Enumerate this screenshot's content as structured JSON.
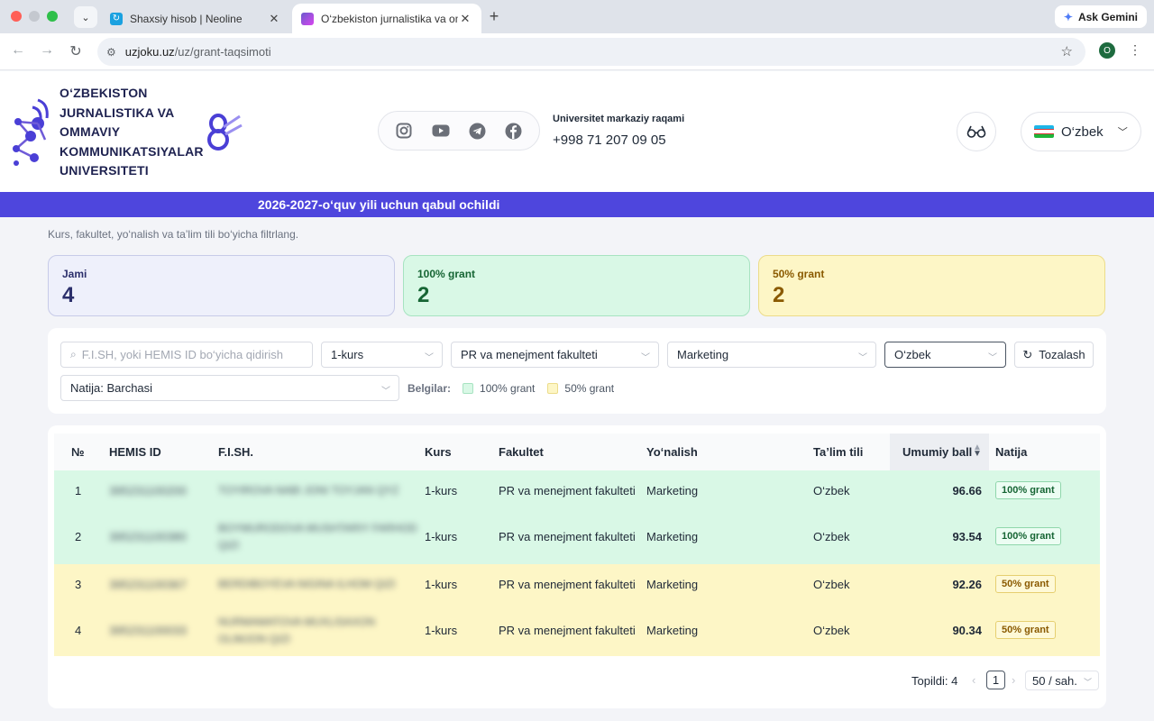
{
  "browser": {
    "tabs": [
      {
        "title": "Shaxsiy hisob | Neoline"
      },
      {
        "title": "O‘zbekiston jurnalistika va om"
      }
    ],
    "ask_gemini": "Ask Gemini",
    "url_host": "uzjoku.uz",
    "url_path": "/uz/grant-taqsimoti",
    "profile_initial": "O"
  },
  "header": {
    "logo_text": "O‘ZBEKISTON JURNALISTIKA VA OMMAVIY KOMMUNIKATSIYALAR UNIVERSITETI",
    "contact_label": "Universitet markaziy raqami",
    "contact_phone": "+998 71 207 09 05",
    "language": "O‘zbek",
    "socials": [
      "instagram-icon",
      "youtube-icon",
      "telegram-icon",
      "facebook-icon"
    ]
  },
  "banner": {
    "text": "2026-2027-o‘quv yili uchun qabul ochildi"
  },
  "page": {
    "subtitle": "Kurs, fakultet, yo‘nalish va ta’lim tili bo‘yicha filtrlang."
  },
  "stats": {
    "total_label": "Jami",
    "total_value": "4",
    "full_label": "100% grant",
    "full_value": "2",
    "half_label": "50% grant",
    "half_value": "2"
  },
  "filters": {
    "search_placeholder": "F.I.SH, yoki HEMIS ID bo‘yicha qidirish",
    "kurs": "1-kurs",
    "fakultet": "PR va menejment fakulteti",
    "yonalish": "Marketing",
    "til": "O‘zbek",
    "reset_label": "Tozalash",
    "natija": "Natija: Barchasi",
    "legend_title": "Belgilar:",
    "legend_full": "100% grant",
    "legend_half": "50% grant"
  },
  "table": {
    "headers": {
      "no": "№",
      "hemis": "HEMIS ID",
      "fish": "F.I.SH.",
      "kurs": "Kurs",
      "fakultet": "Fakultet",
      "yonalish": "Yo‘nalish",
      "til": "Ta’lim tili",
      "ball": "Umumiy ball",
      "natija": "Natija"
    },
    "rows": [
      {
        "no": "1",
        "hemis": "395231100200",
        "fish_1": "TOYIROVA NABI JONI TOYJAN QYZ",
        "fish_2": "",
        "kurs": "1-kurs",
        "fakultet": "PR va menejment fakulteti",
        "yonalish": "Marketing",
        "til": "O‘zbek",
        "ball": "96.66",
        "natija": "100% grant"
      },
      {
        "no": "2",
        "hemis": "395231100380",
        "fish_1": "BOYMURODOVA MUSHTARIY FARHOD",
        "fish_2": "QIZI",
        "kurs": "1-kurs",
        "fakultet": "PR va menejment fakulteti",
        "yonalish": "Marketing",
        "til": "O‘zbek",
        "ball": "93.54",
        "natija": "100% grant"
      },
      {
        "no": "3",
        "hemis": "395231100367",
        "fish_1": "BERDIBOYEVA NIGINA ILHOM QIZI",
        "fish_2": "",
        "kurs": "1-kurs",
        "fakultet": "PR va menejment fakulteti",
        "yonalish": "Marketing",
        "til": "O‘zbek",
        "ball": "92.26",
        "natija": "50% grant"
      },
      {
        "no": "4",
        "hemis": "395231100033",
        "fish_1": "NURMAMATOVA MUXLISAXON",
        "fish_2": "OLIMJON QIZI",
        "kurs": "1-kurs",
        "fakultet": "PR va menejment fakulteti",
        "yonalish": "Marketing",
        "til": "O‘zbek",
        "ball": "90.34",
        "natija": "50% grant"
      }
    ]
  },
  "pagination": {
    "total": "Topildi: 4",
    "current": "1",
    "page_size": "50 / sah."
  }
}
